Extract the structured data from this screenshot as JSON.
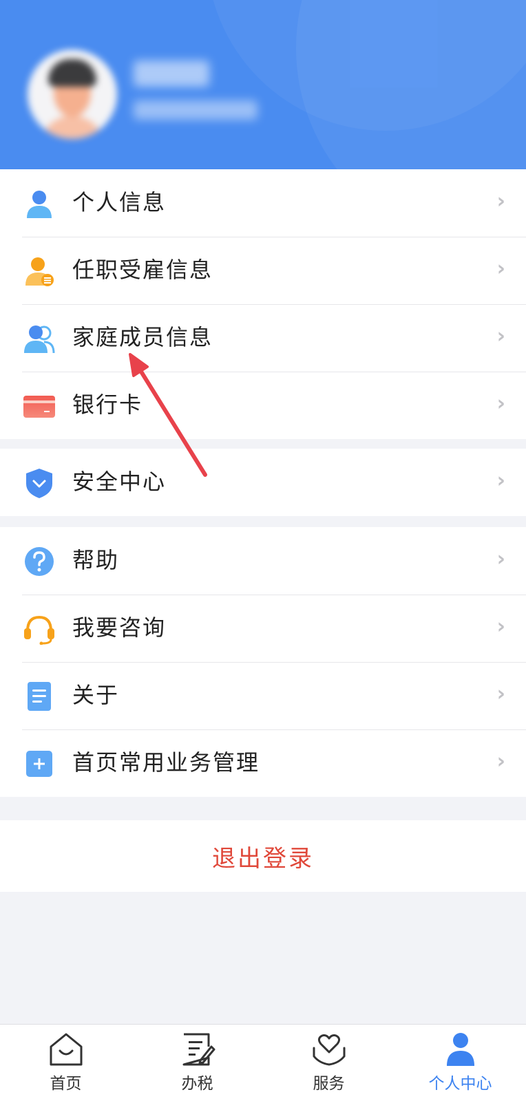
{
  "menu_group_1": [
    {
      "label": "个人信息",
      "icon": "user-icon"
    },
    {
      "label": "任职受雇信息",
      "icon": "employment-info-icon"
    },
    {
      "label": "家庭成员信息",
      "icon": "family-members-icon"
    },
    {
      "label": "银行卡",
      "icon": "bank-card-icon"
    }
  ],
  "menu_group_2": [
    {
      "label": "安全中心",
      "icon": "shield-icon"
    }
  ],
  "menu_group_3": [
    {
      "label": "帮助",
      "icon": "help-icon"
    },
    {
      "label": "我要咨询",
      "icon": "headset-icon"
    },
    {
      "label": "关于",
      "icon": "document-icon"
    },
    {
      "label": "首页常用业务管理",
      "icon": "add-square-icon"
    }
  ],
  "chevron": "›",
  "logout_label": "退出登录",
  "tabbar": [
    {
      "label": "首页",
      "icon": "home-icon",
      "active": false
    },
    {
      "label": "办税",
      "icon": "edit-document-icon",
      "active": false
    },
    {
      "label": "服务",
      "icon": "heart-hands-icon",
      "active": false
    },
    {
      "label": "个人中心",
      "icon": "profile-icon",
      "active": true
    }
  ],
  "colors": {
    "header_blue": "#4a8cf0",
    "accent_blue": "#3d83f0",
    "logout_red": "#e0483a",
    "arrow_red": "#e8424b"
  }
}
